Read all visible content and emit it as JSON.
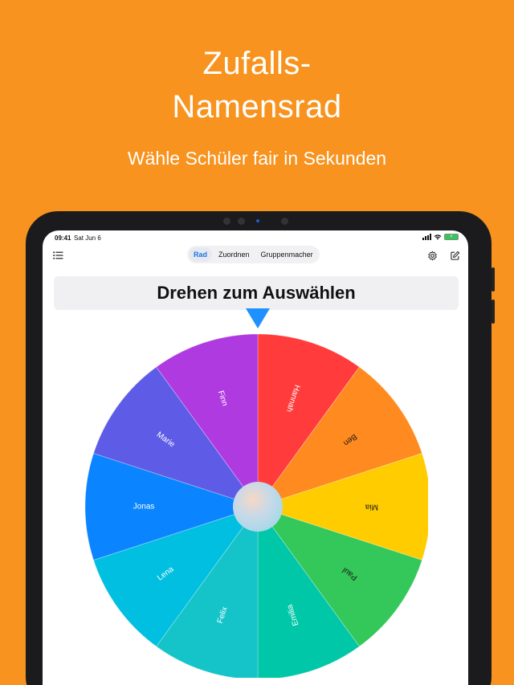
{
  "marketing": {
    "title_line1": "Zufalls-",
    "title_line2": "Namensrad",
    "subtitle": "Wähle Schüler fair in Sekunden"
  },
  "status_bar": {
    "time": "09:41",
    "date": "Sat Jun 6"
  },
  "toolbar": {
    "list_icon": "list-icon",
    "settings_icon": "gear-icon",
    "edit_icon": "compose-icon",
    "tabs": [
      {
        "label": "Rad",
        "active": true
      },
      {
        "label": "Zuordnen",
        "active": false
      },
      {
        "label": "Gruppenmacher",
        "active": false
      }
    ]
  },
  "wheel": {
    "title": "Drehen zum Auswählen",
    "pointer_color": "#1E90FF",
    "segments": [
      {
        "name": "Hannah",
        "color": "#FF3B3B",
        "text": "light"
      },
      {
        "name": "Ben",
        "color": "#FF8A1F",
        "text": "dark"
      },
      {
        "name": "Mia",
        "color": "#FFCC00",
        "text": "dark"
      },
      {
        "name": "Paul",
        "color": "#34C759",
        "text": "dark"
      },
      {
        "name": "Emilia",
        "color": "#00C7A8",
        "text": "light"
      },
      {
        "name": "Felix",
        "color": "#14C4C8",
        "text": "light"
      },
      {
        "name": "Lena",
        "color": "#00BFE0",
        "text": "light"
      },
      {
        "name": "Jonas",
        "color": "#0A84FF",
        "text": "light"
      },
      {
        "name": "Marie",
        "color": "#5E5CE6",
        "text": "light"
      },
      {
        "name": "Finn",
        "color": "#AF3BE0",
        "text": "light"
      }
    ]
  }
}
